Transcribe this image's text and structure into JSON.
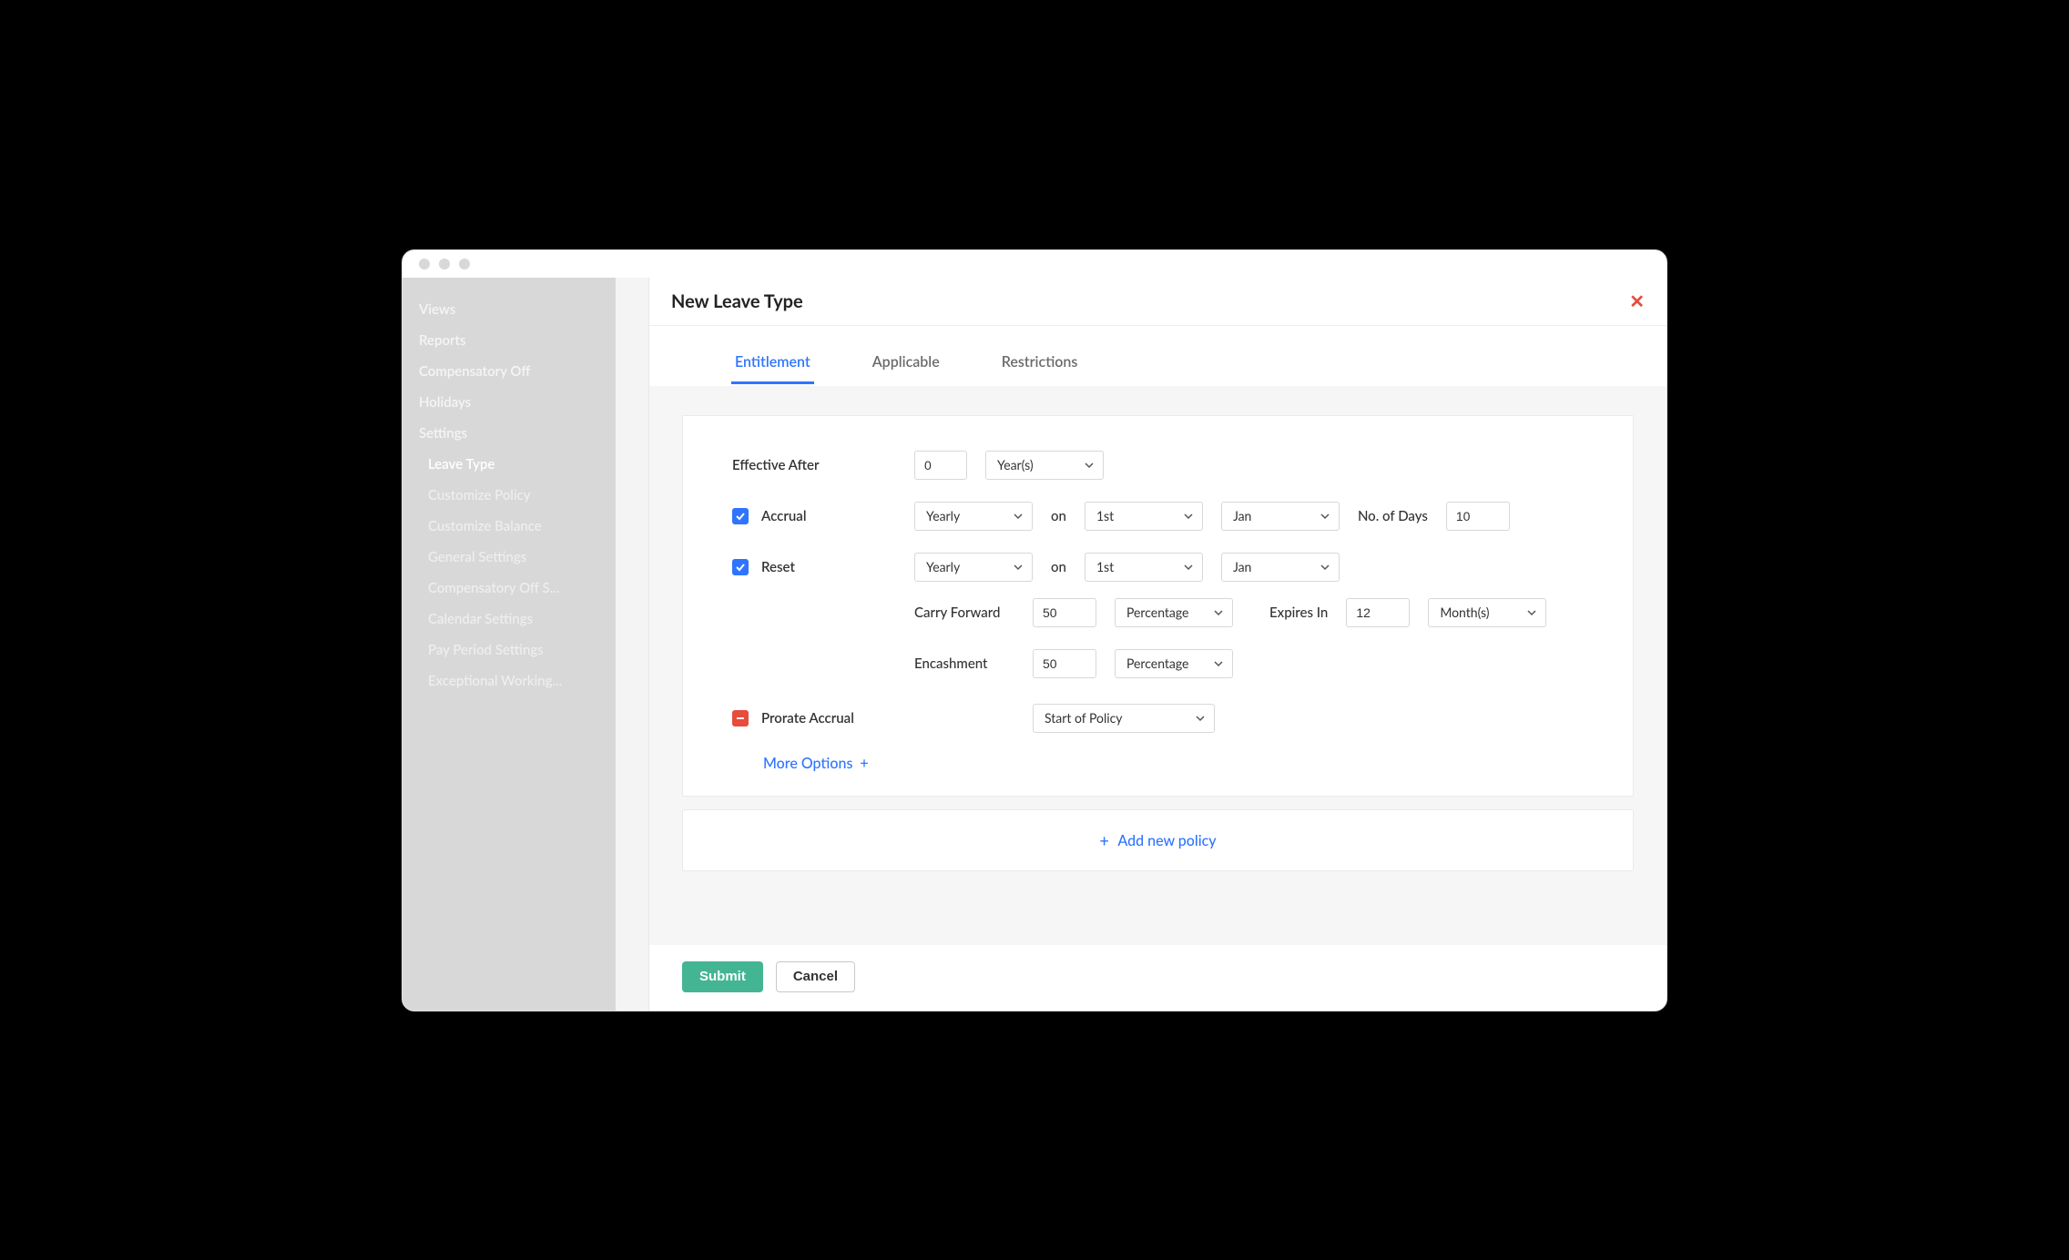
{
  "sidebar": {
    "items": [
      "Views",
      "Reports",
      "Compensatory Off",
      "Holidays",
      "Settings"
    ],
    "sub": [
      "Leave Type",
      "Customize Policy",
      "Customize Balance",
      "General Settings",
      "Compensatory Off S...",
      "Calendar Settings",
      "Pay Period Settings",
      "Exceptional Working..."
    ]
  },
  "panel": {
    "title": "New Leave Type",
    "tabs": [
      "Entitlement",
      "Applicable",
      "Restrictions"
    ]
  },
  "form": {
    "effective_after_label": "Effective After",
    "effective_after_value": "0",
    "effective_after_unit": "Year(s)",
    "accrual_label": "Accrual",
    "reset_label": "Reset",
    "freq": "Yearly",
    "on": "on",
    "day": "1st",
    "month": "Jan",
    "num_days_label": "No. of Days",
    "num_days_value": "10",
    "carry_forward_label": "Carry Forward",
    "carry_forward_value": "50",
    "percentage": "Percentage",
    "expires_in_label": "Expires In",
    "expires_in_value": "12",
    "expires_in_unit": "Month(s)",
    "encashment_label": "Encashment",
    "encashment_value": "50",
    "prorate_label": "Prorate Accrual",
    "prorate_value": "Start of Policy",
    "more_options": "More Options",
    "add_new_policy": "Add new policy"
  },
  "footer": {
    "submit": "Submit",
    "cancel": "Cancel"
  }
}
